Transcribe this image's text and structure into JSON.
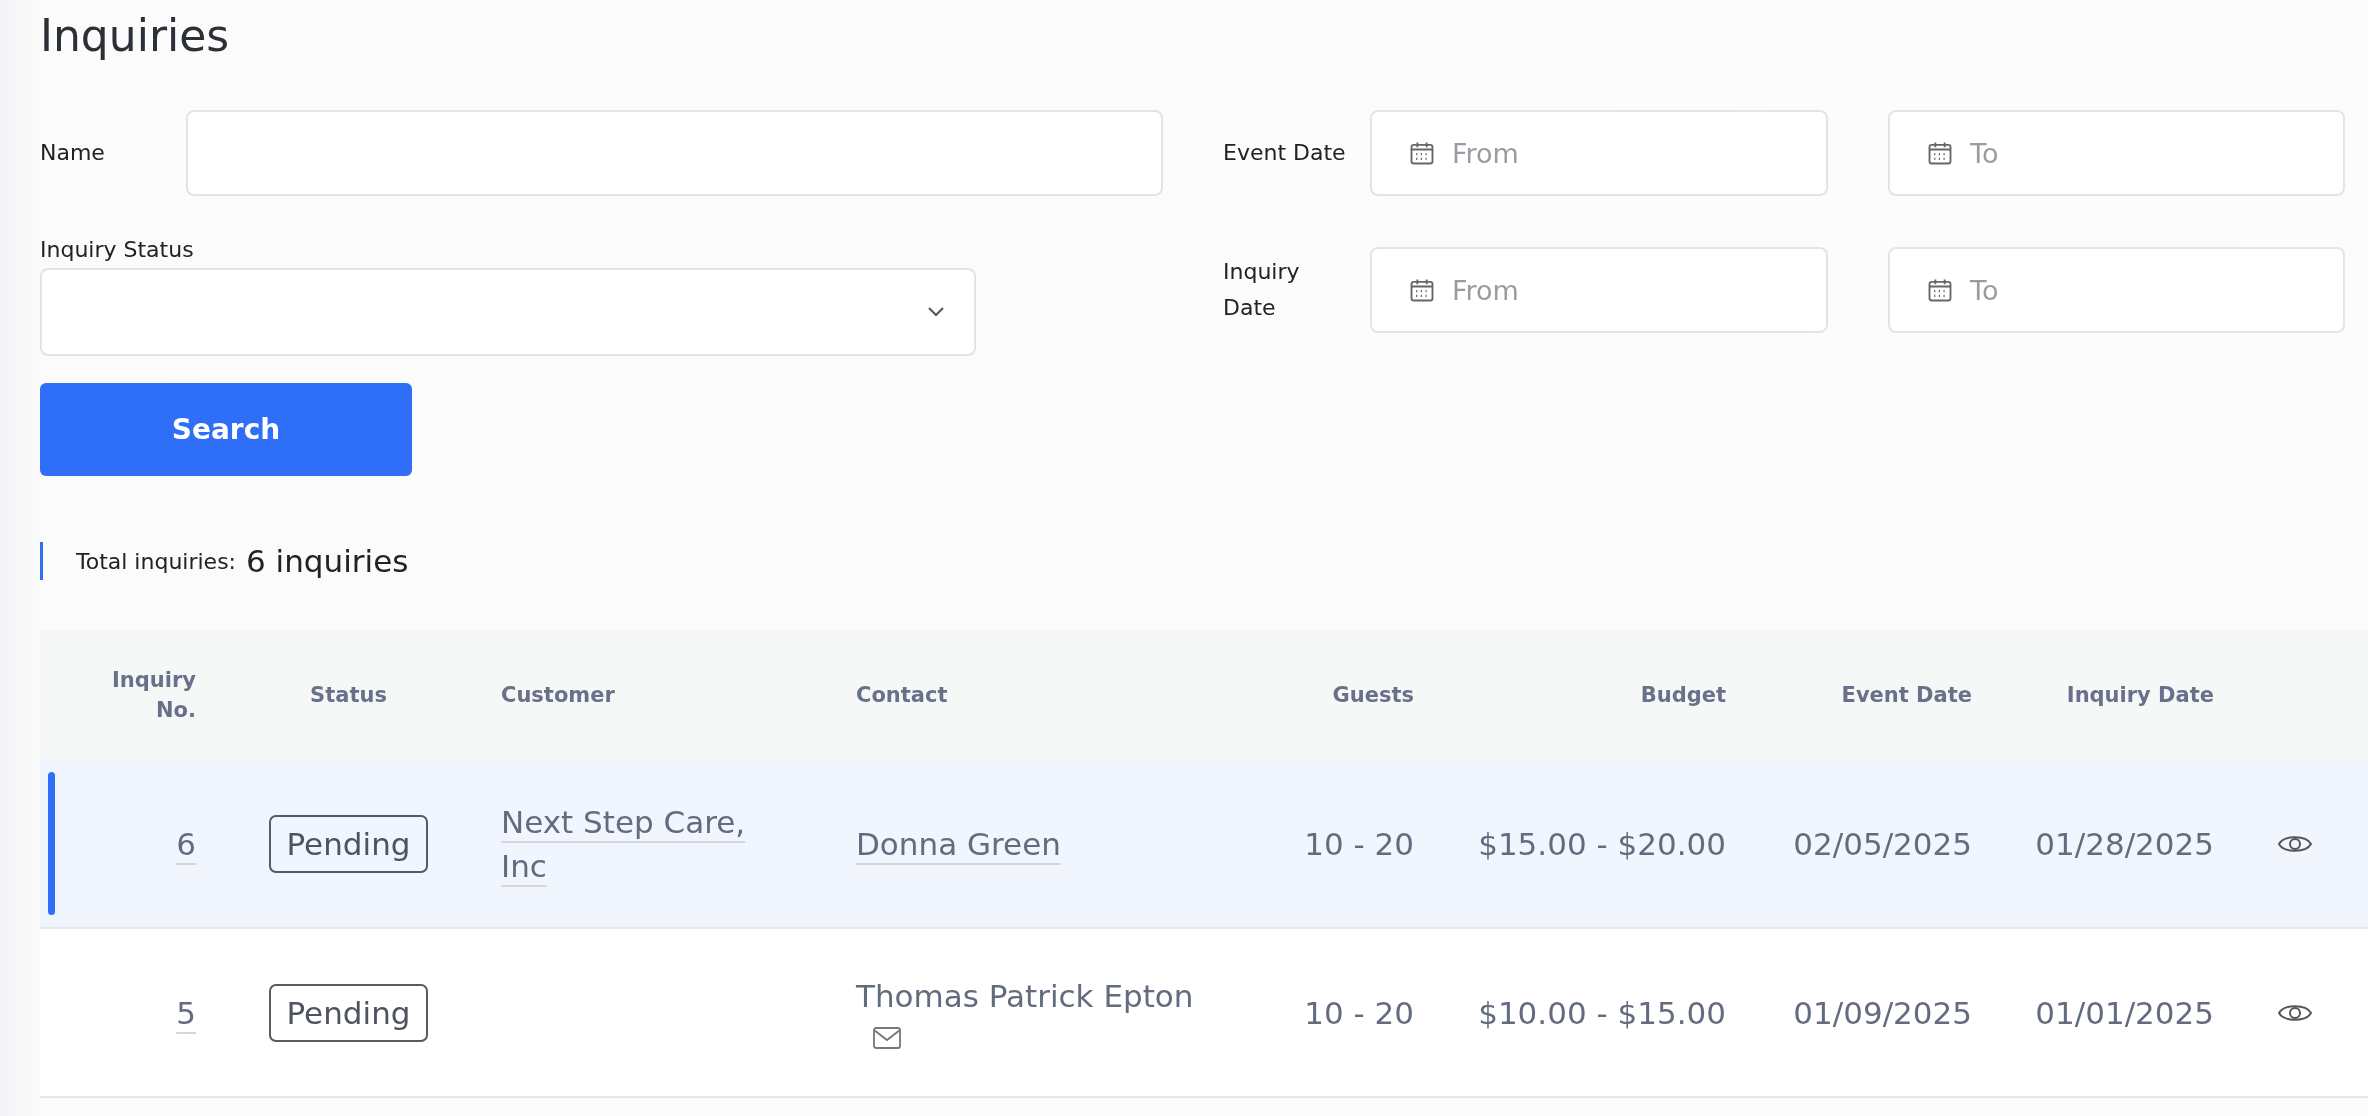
{
  "title": "Inquiries",
  "filters": {
    "name": {
      "label": "Name"
    },
    "event_date": {
      "label": "Event Date",
      "from_placeholder": "From",
      "to_placeholder": "To"
    },
    "inquiry_status": {
      "label": "Inquiry Status"
    },
    "inquiry_date": {
      "label": "Inquiry Date",
      "from_placeholder": "From",
      "to_placeholder": "To"
    },
    "search_button": "Search"
  },
  "total": {
    "label": "Total inquiries:",
    "count": "6 inquiries"
  },
  "table": {
    "columns": [
      "Inquiry No.",
      "Status",
      "Customer",
      "Contact",
      "Guests",
      "Budget",
      "Event Date",
      "Inquiry Date"
    ],
    "rows": [
      {
        "selected": true,
        "number": "6",
        "status": "Pending",
        "customer": "Next Step Care, Inc",
        "contact": "Donna Green",
        "contact_link": true,
        "email": false,
        "guests": "10 - 20",
        "budget": "$15.00 - $20.00",
        "event_date": "02/05/2025",
        "inquiry_date": "01/28/2025"
      },
      {
        "selected": false,
        "number": "5",
        "status": "Pending",
        "contact": "Thomas Patrick Epton",
        "contact_link": false,
        "email": true,
        "guests": "10 - 20",
        "budget": "$10.00 - $15.00",
        "event_date": "01/09/2025",
        "inquiry_date": "01/01/2025"
      }
    ]
  }
}
